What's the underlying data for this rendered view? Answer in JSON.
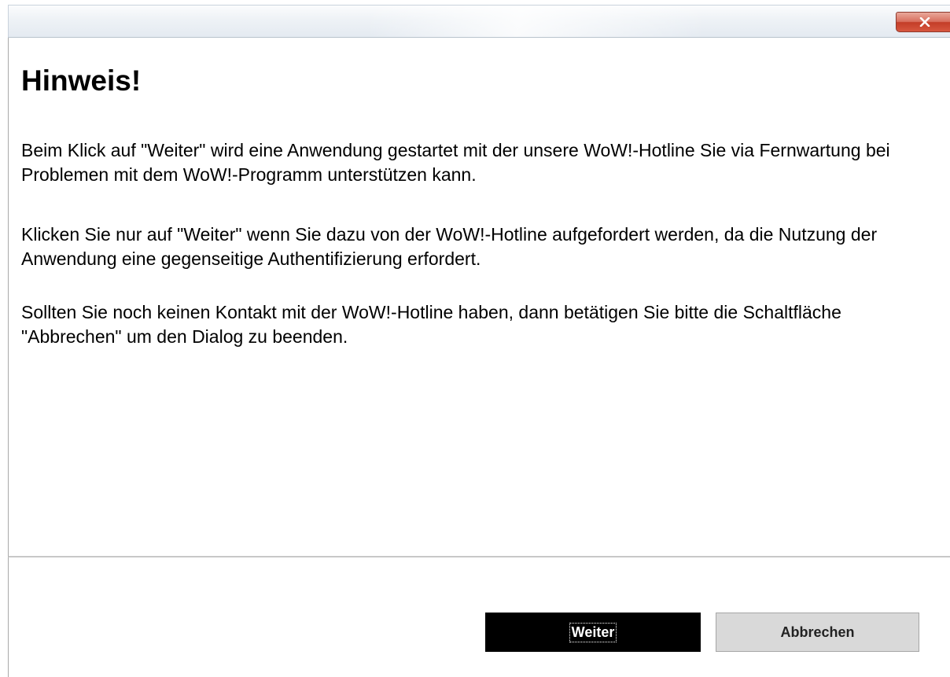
{
  "dialog": {
    "close_glyph": "close-icon",
    "heading": "Hinweis!",
    "paragraphs": [
      "Beim Klick auf \"Weiter\" wird eine Anwendung gestartet mit der unsere WoW!-Hotline Sie via Fernwartung bei Problemen mit dem WoW!-Programm unterstützen kann.",
      "Klicken Sie nur auf \"Weiter\" wenn Sie dazu von der WoW!-Hotline aufgefordert werden, da die Nutzung der Anwendung eine gegenseitige Authentifizierung erfordert.",
      "Sollten Sie noch keinen Kontakt mit der WoW!-Hotline haben, dann betätigen Sie bitte die Schaltfläche \"Abbrechen\" um den Dialog zu beenden."
    ]
  },
  "buttons": {
    "weiter_label": "Weiter",
    "abbrechen_label": "Abbrechen"
  },
  "colors": {
    "close_button": "#c94a36",
    "primary_button_bg": "#000000",
    "secondary_button_bg": "#d9d9d9"
  }
}
